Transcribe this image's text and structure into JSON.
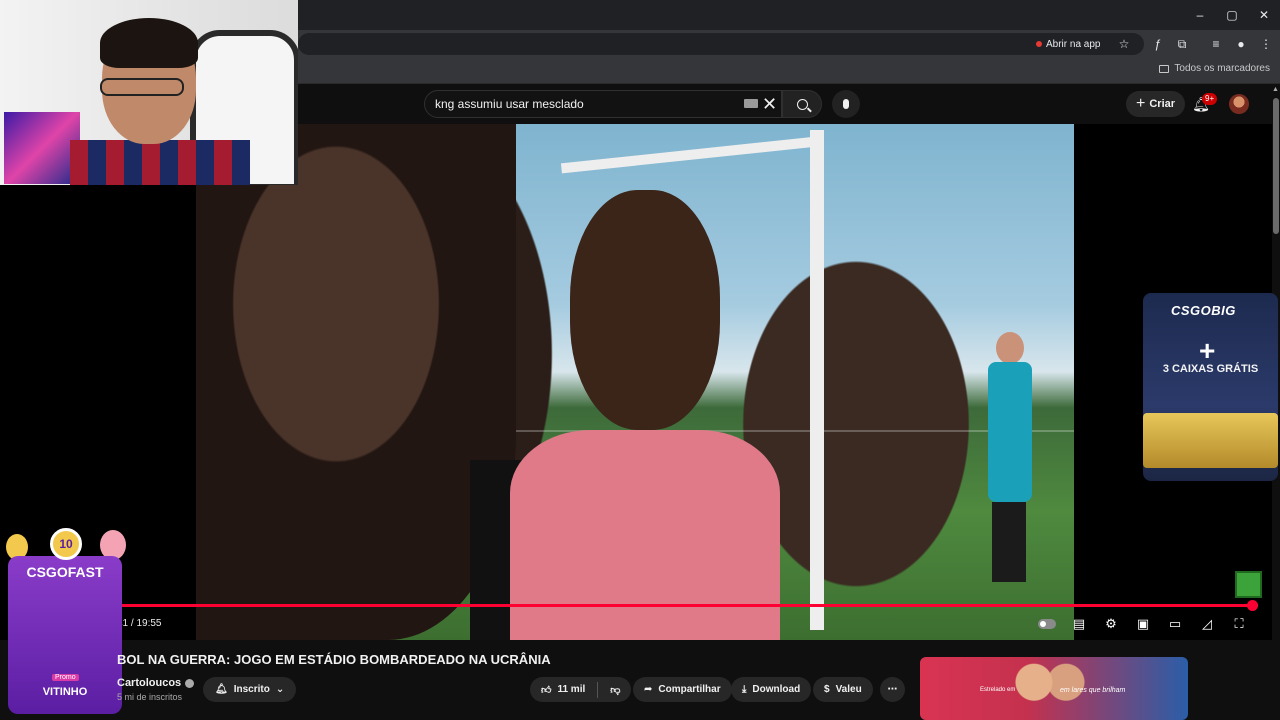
{
  "browser": {
    "open_in_app": "Abrir na app",
    "all_bookmarks": "Todos os marcadores",
    "window_controls": [
      "–",
      "▢",
      "✕"
    ]
  },
  "youtube": {
    "search_value": "kng assumiu usar mesclado",
    "create_label": "Criar",
    "notifications_count": "9+"
  },
  "player": {
    "progress": 0.995,
    "time": "41 / 19:55"
  },
  "video": {
    "title": "BOL NA GUERRA: JOGO EM ESTÁDIO BOMBARDEADO NA UCRÂNIA",
    "channel": "Cartoloucos",
    "subscribers": "5 mi de inscritos",
    "subscribed_label": "Inscrito",
    "likes": "11 mil",
    "share_label": "Compartilhar",
    "download_label": "Download",
    "thanks_label": "Valeu"
  },
  "ads": {
    "csgobig_logo": "CSGOBIG",
    "csgobig_offer": "3 CAIXAS GRÁTIS",
    "csgofast_badge": "10",
    "csgofast_brand": "CSGOFAST",
    "csgofast_promo": "Promo",
    "csgofast_user": "VITINHO",
    "side_ad_text1": "Estrelado em",
    "side_ad_text2": "em lares que brilham"
  },
  "colors": {
    "accent": "#ff0033",
    "background": "#0f0f0f",
    "pill": "#272727"
  }
}
